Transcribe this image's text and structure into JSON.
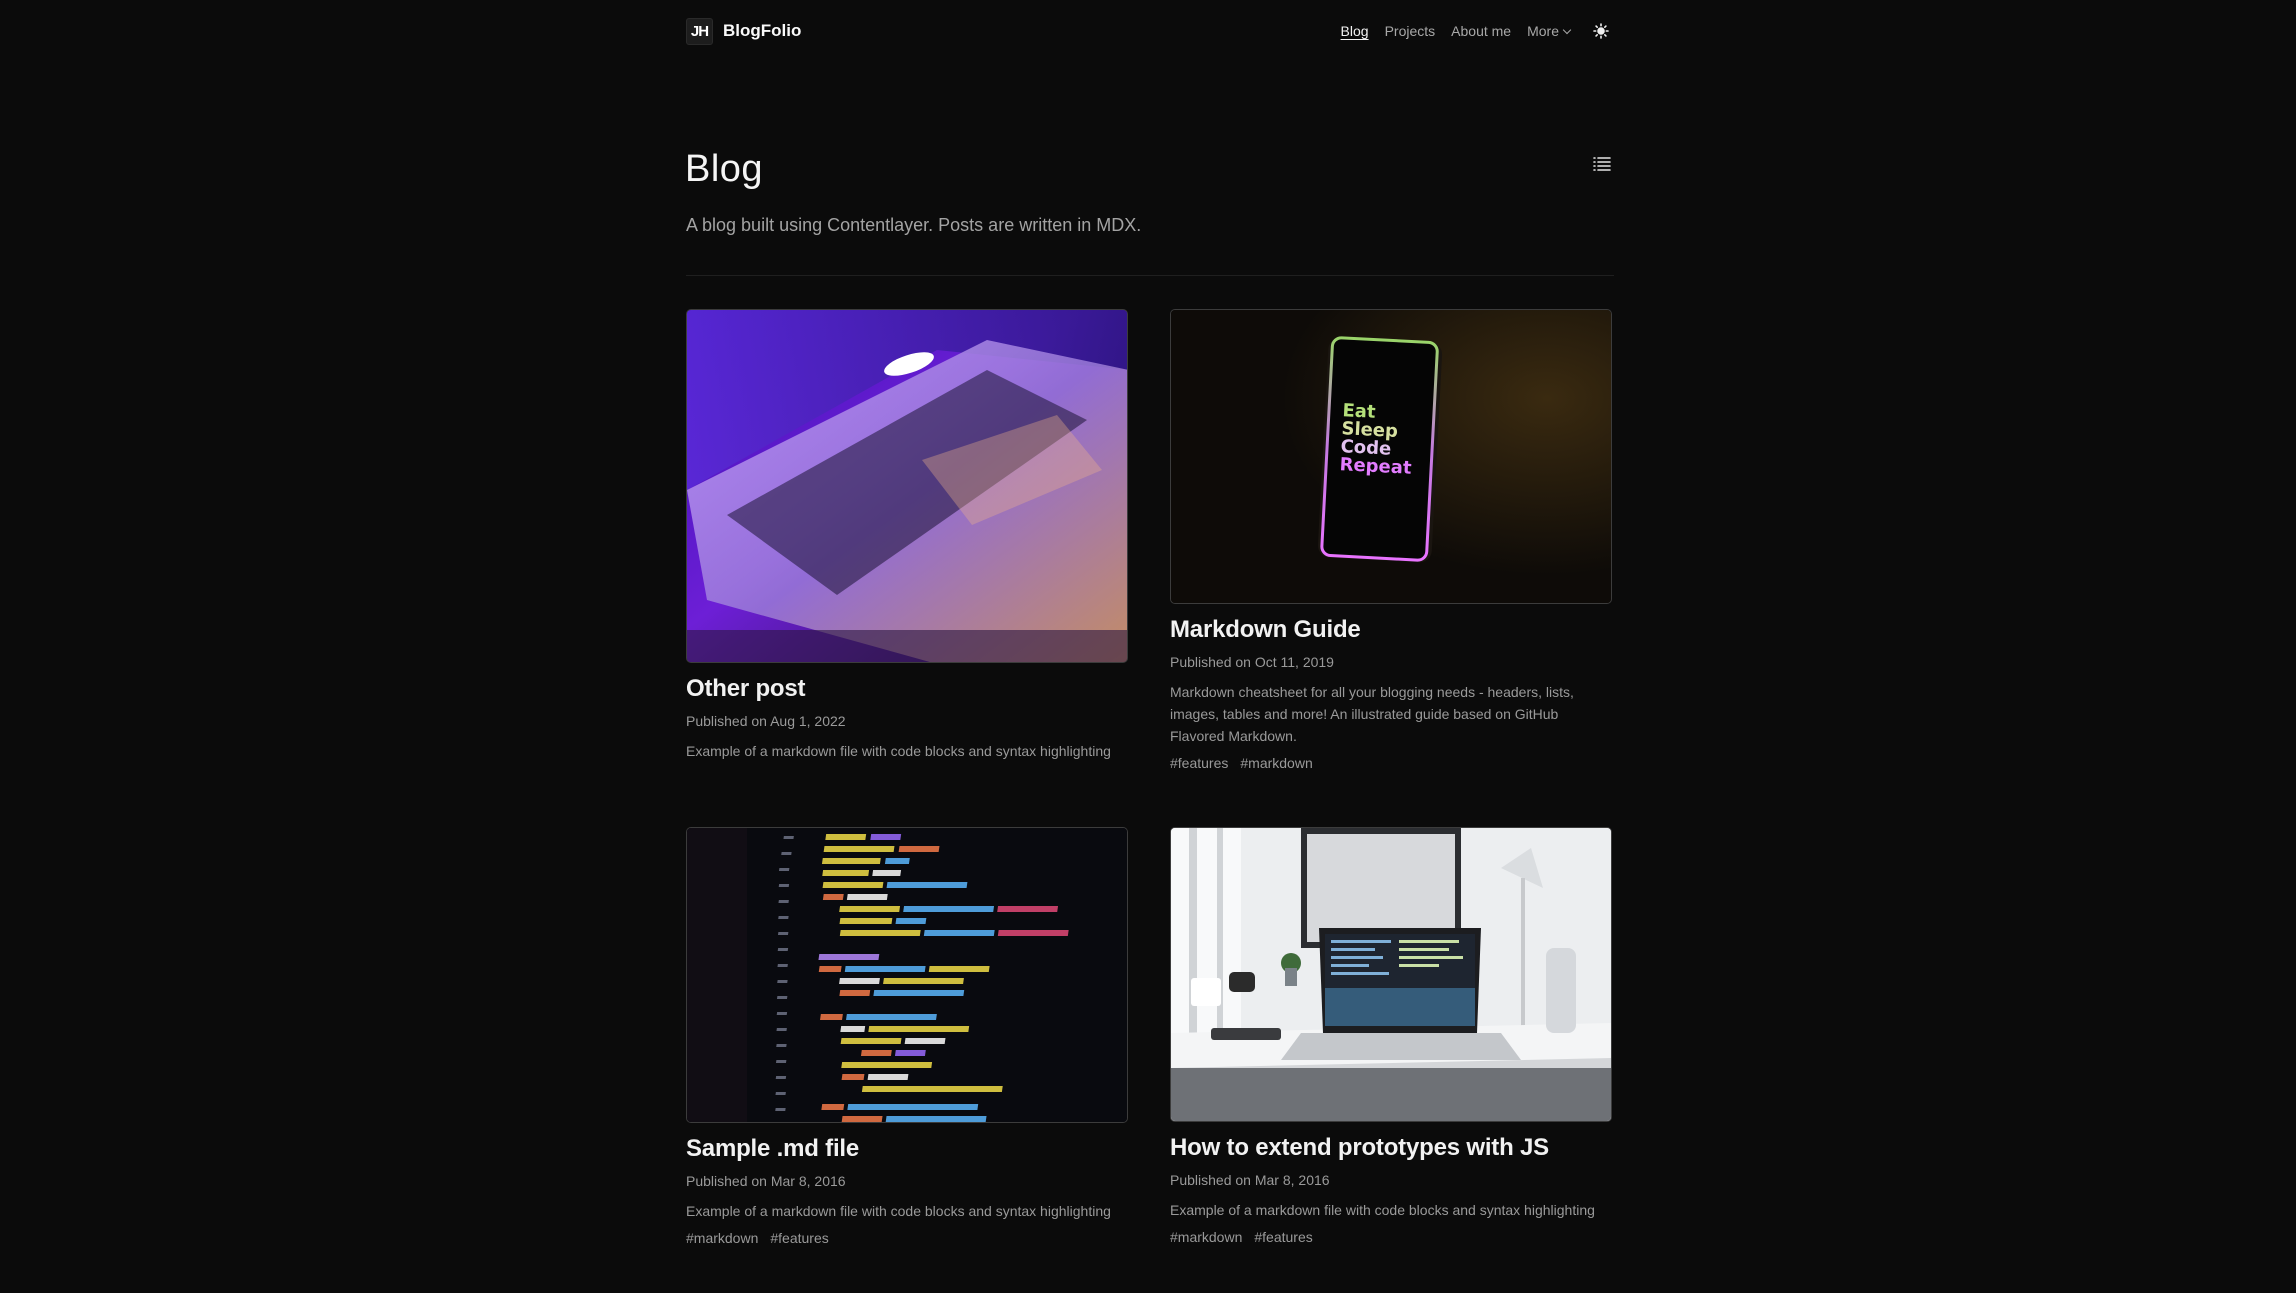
{
  "header": {
    "logo_mark": "JH",
    "logo_text": "BlogFolio",
    "nav": [
      "Blog",
      "Projects",
      "About me",
      "More"
    ]
  },
  "intro": {
    "title": "Blog",
    "subtitle": "A blog built using Contentlayer. Posts are written in MDX."
  },
  "posts": [
    {
      "title": "Other post",
      "date": "Published on Aug 1, 2022",
      "description": "Example of a markdown file with code blocks and syntax highlighting",
      "tags": [],
      "image": "laptop-purple-glow"
    },
    {
      "title": "Markdown Guide",
      "date": "Published on Oct 11, 2019",
      "description": "Markdown cheatsheet for all your blogging needs - headers, lists, images, tables and more! An illustrated guide based on GitHub Flavored Markdown.",
      "tags": [
        "#features",
        "#markdown"
      ],
      "image": "phone-eat-sleep-code-repeat",
      "image_text": [
        "Eat",
        "Sleep",
        "Code",
        "Repeat"
      ]
    },
    {
      "title": "Sample .md file",
      "date": "Published on Mar 8, 2016",
      "description": "Example of a markdown file with code blocks and syntax highlighting",
      "tags": [
        "#markdown",
        "#features"
      ],
      "image": "code-on-screen"
    },
    {
      "title": "How to extend prototypes with JS",
      "date": "Published on Mar 8, 2016",
      "description": "Example of a markdown file with code blocks and syntax highlighting",
      "tags": [
        "#markdown",
        "#features"
      ],
      "image": "laptop-on-desk"
    }
  ],
  "icons": {
    "theme": "sun-icon",
    "toc": "list-icon",
    "more": "chevron-down-icon"
  },
  "colors": {
    "background": "#0b0b0b",
    "text": "#ededed",
    "muted": "#9a9a9a",
    "border": "#3c3c3c"
  }
}
